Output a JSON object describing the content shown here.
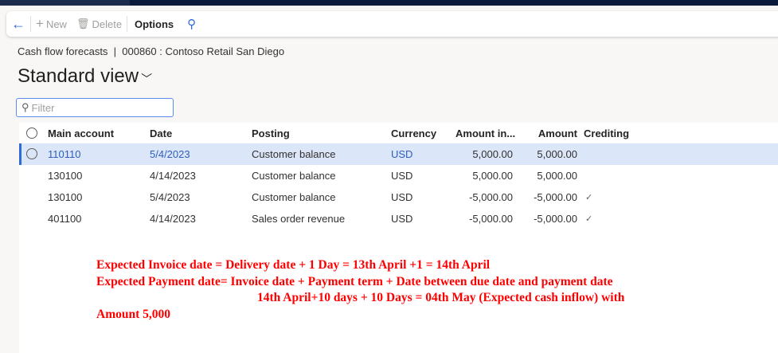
{
  "toolbar": {
    "new": "New",
    "delete": "Delete",
    "options": "Options"
  },
  "breadcrumb": "Cash flow forecasts  |  000860 : Contoso Retail San Diego",
  "view_title": "Standard view",
  "filter_placeholder": "Filter",
  "columns": [
    "Main account",
    "Date",
    "Posting",
    "Currency",
    "Amount in...",
    "Amount",
    "Crediting"
  ],
  "rows": [
    {
      "account": "110110",
      "date": "5/4/2023",
      "posting": "Customer balance",
      "currency": "USD",
      "amount_in": "5,000.00",
      "amount": "5,000.00",
      "crediting": ""
    },
    {
      "account": "130100",
      "date": "4/14/2023",
      "posting": "Customer balance",
      "currency": "USD",
      "amount_in": "5,000.00",
      "amount": "5,000.00",
      "crediting": ""
    },
    {
      "account": "130100",
      "date": "5/4/2023",
      "posting": "Customer balance",
      "currency": "USD",
      "amount_in": "-5,000.00",
      "amount": "-5,000.00",
      "crediting": "✓"
    },
    {
      "account": "401100",
      "date": "4/14/2023",
      "posting": "Sales order revenue",
      "currency": "USD",
      "amount_in": "-5,000.00",
      "amount": "-5,000.00",
      "crediting": "✓"
    }
  ],
  "annotation": [
    "Expected Invoice date = Delivery date + 1 Day = 13th April +1 = 14th April",
    "Expected Payment date= Invoice date + Payment term + Date between due date and payment date",
    "14th April+10 days + 10 Days = 04th May (Expected cash inflow) with",
    "Amount 5,000"
  ]
}
